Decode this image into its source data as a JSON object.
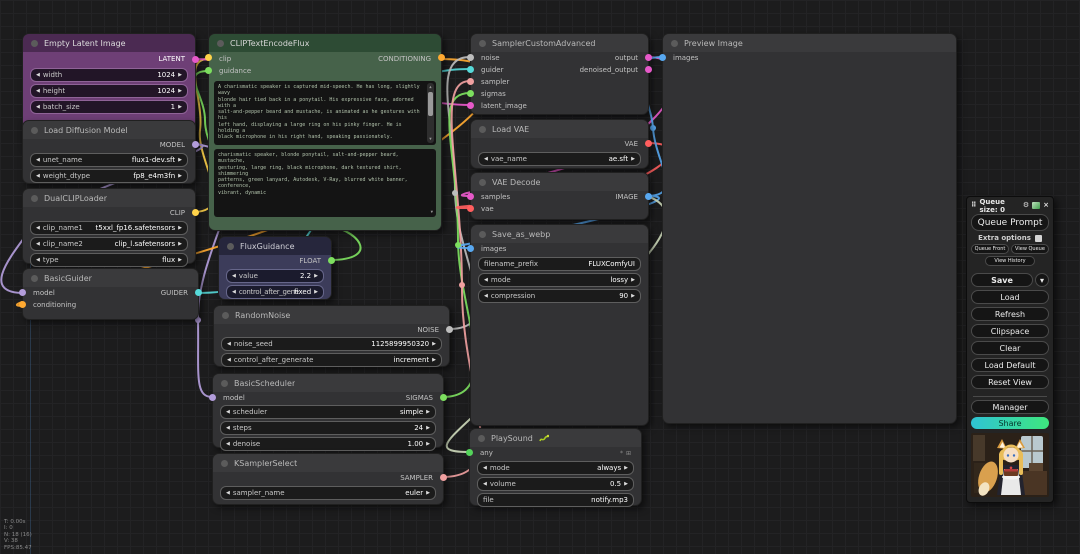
{
  "colors": {
    "latent": "#e759c9",
    "model": "#b39ddb",
    "clip": "#ffd34a",
    "conditioning": "#ffa931",
    "guider": "#56d9d9",
    "green": "#7ddf5f",
    "noise": "#bdbdbd",
    "sampler": "#f0a0a0",
    "vae": "#ff5e5e",
    "image": "#58a8f0",
    "any": "#54d35a",
    "pale": "#ccd8ba",
    "purple_header": "#4b2a52",
    "purple_body": "#6e3f76",
    "green_header": "#2d4b34",
    "green_body": "#46624a",
    "navy_header": "#26263c",
    "navy_body": "#3c3c5a"
  },
  "icons": {
    "left_arrow": "◀",
    "right_arrow": "▶",
    "gear": "⚙",
    "close": "×",
    "caret": "▾",
    "handle": "⠿",
    "grid": "⊞",
    "asterisk": "*",
    "scroll_up": "▲",
    "scroll_down": "▼"
  },
  "nodes": {
    "empty_latent": {
      "title": "Empty Latent Image",
      "out0": "LATENT",
      "widgets": [
        {
          "label": "width",
          "value": "1024"
        },
        {
          "label": "height",
          "value": "1024"
        },
        {
          "label": "batch_size",
          "value": "1"
        }
      ]
    },
    "load_diffusion": {
      "title": "Load Diffusion Model",
      "out0": "MODEL",
      "widgets": [
        {
          "label": "unet_name",
          "value": "flux1-dev.sft"
        },
        {
          "label": "weight_dtype",
          "value": "fp8_e4m3fn"
        }
      ]
    },
    "dual_clip": {
      "title": "DualCLIPLoader",
      "out0": "CLIP",
      "widgets": [
        {
          "label": "clip_name1",
          "value": "t5xxl_fp16.safetensors"
        },
        {
          "label": "clip_name2",
          "value": "clip_l.safetensors"
        },
        {
          "label": "type",
          "value": "flux"
        }
      ]
    },
    "basic_guider": {
      "title": "BasicGuider",
      "in0": "model",
      "in1": "conditioning",
      "out0": "GUIDER"
    },
    "clip_text": {
      "title": "CLIPTextEncodeFlux",
      "in0": "clip",
      "in1": "guidance",
      "out0": "CONDITIONING",
      "prompt": "A charismatic speaker is captured mid-speech. He has long, slightly wavy\nblonde hair tied back in a ponytail. His expressive face, adorned with a\nsalt-and-pepper beard and mustache, is animated as he gestures with his\nleft hand, displaying a large ring on his pinky finger. He is holding a\nblack microphone in his right hand, speaking passionately.\n\nThe man is wearing a dark, textured shirt with unique, slightly shimmering\npatterns, and a green lanyard with multiple badges and logos hanging around\nhis neck. The lanyard features the \"Autodesk\" and \"V-Ray\" logos\nprominently.",
      "tags": "charismatic speaker, blonde ponytail, salt-and-pepper beard, mustache,\ngesturing, large ring, black microphone, dark textured shirt, shimmering\npatterns, green lanyard, Autodesk, V-Ray, blurred white banner, conference,\nvibrant, dynamic"
    },
    "flux_guidance": {
      "title": "FluxGuidance",
      "out0": "FLOAT",
      "widgets": [
        {
          "label": "value",
          "value": "2.2"
        },
        {
          "label": "control_after_gene",
          "value": "fixed"
        }
      ]
    },
    "random_noise": {
      "title": "RandomNoise",
      "out0": "NOISE",
      "widgets": [
        {
          "label": "noise_seed",
          "value": "1125899950320"
        },
        {
          "label": "control_after_generate",
          "value": "increment"
        }
      ]
    },
    "basic_scheduler": {
      "title": "BasicScheduler",
      "in0": "model",
      "out0": "SIGMAS",
      "widgets": [
        {
          "label": "scheduler",
          "value": "simple"
        },
        {
          "label": "steps",
          "value": "24"
        },
        {
          "label": "denoise",
          "value": "1.00"
        }
      ]
    },
    "ksampler_select": {
      "title": "KSamplerSelect",
      "out0": "SAMPLER",
      "widgets": [
        {
          "label": "sampler_name",
          "value": "euler"
        }
      ]
    },
    "sampler_custom": {
      "title": "SamplerCustomAdvanced",
      "in0": "noise",
      "in1": "guider",
      "in2": "sampler",
      "in3": "sigmas",
      "in4": "latent_image",
      "out0": "output",
      "out1": "denoised_output"
    },
    "load_vae": {
      "title": "Load VAE",
      "out0": "VAE",
      "widgets": [
        {
          "label": "vae_name",
          "value": "ae.sft"
        }
      ]
    },
    "vae_decode": {
      "title": "VAE Decode",
      "in0": "samples",
      "in1": "vae",
      "out0": "IMAGE"
    },
    "save_webp": {
      "title": "Save_as_webp",
      "in0": "images",
      "widgets": [
        {
          "label": "filename_prefix",
          "value": "FLUXComfyUI"
        },
        {
          "label": "mode",
          "value": "lossy"
        },
        {
          "label": "compression",
          "value": "90"
        }
      ]
    },
    "play_sound": {
      "title": "PlaySound",
      "in0": "any",
      "widgets": [
        {
          "label": "mode",
          "value": "always"
        },
        {
          "label": "volume",
          "value": "0.5"
        },
        {
          "label": "file",
          "value": "notify.mp3"
        }
      ]
    },
    "preview_image": {
      "title": "Preview Image",
      "in0": "images"
    }
  },
  "menu": {
    "queue_size": "Queue size: 0",
    "queue_prompt": "Queue Prompt",
    "extra_options": "Extra options",
    "queue_front": "Queue Front",
    "view_queue": "View Queue",
    "view_history": "View History",
    "save": "Save",
    "load": "Load",
    "refresh": "Refresh",
    "clipspace": "Clipspace",
    "clear": "Clear",
    "load_default": "Load Default",
    "reset_view": "Reset View",
    "manager": "Manager",
    "share": "Share"
  },
  "stats": {
    "l1": "T: 0.00s",
    "l2": "I: 0",
    "l3": "N: 18 (16)",
    "l4": "V: 38",
    "l5": "FPS:85.47"
  }
}
